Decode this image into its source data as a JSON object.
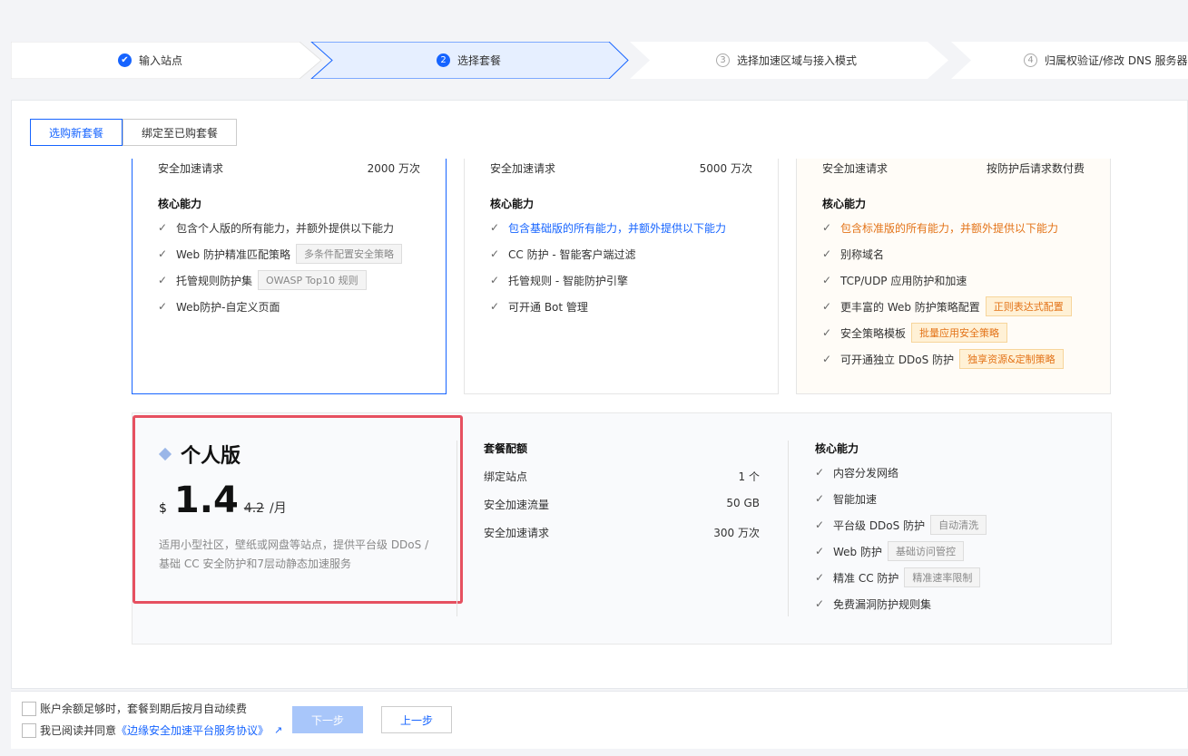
{
  "stepper": {
    "steps": [
      {
        "num": "✔",
        "label": "输入站点",
        "state": "done"
      },
      {
        "num": "2",
        "label": "选择套餐",
        "state": "active"
      },
      {
        "num": "3",
        "label": "选择加速区域与接入模式",
        "state": "todo"
      },
      {
        "num": "4",
        "label": "归属权验证/修改 DNS 服务器",
        "state": "todo"
      }
    ]
  },
  "tabs": {
    "buy_new": "选购新套餐",
    "bind_existing": "绑定至已购套餐"
  },
  "cards": [
    {
      "quota_label": "安全加速请求",
      "quota_value": "2000 万次",
      "core_title": "核心能力",
      "features": [
        {
          "text": "包含个人版的所有能力，并额外提供以下能力",
          "tag": ""
        },
        {
          "text": "Web 防护精准匹配策略",
          "tag": "多条件配置安全策略"
        },
        {
          "text": "托管规则防护集",
          "tag": "OWASP Top10 规则"
        },
        {
          "text": "Web防护-自定义页面",
          "tag": ""
        }
      ]
    },
    {
      "quota_label": "安全加速请求",
      "quota_value": "5000 万次",
      "core_title": "核心能力",
      "features": [
        {
          "text": "包含基础版的所有能力，并额外提供以下能力",
          "tag": ""
        },
        {
          "text": "CC 防护 - 智能客户端过滤",
          "tag": ""
        },
        {
          "text": "托管规则 - 智能防护引擎",
          "tag": ""
        },
        {
          "text": "可开通 Bot 管理",
          "tag": ""
        }
      ]
    },
    {
      "quota_label": "安全加速请求",
      "quota_value": "按防护后请求数付费",
      "core_title": "核心能力",
      "features": [
        {
          "text": "包含标准版的所有能力，并额外提供以下能力",
          "tag": ""
        },
        {
          "text": "别称域名",
          "tag": ""
        },
        {
          "text": "TCP/UDP 应用防护和加速",
          "tag": ""
        },
        {
          "text": "更丰富的 Web 防护策略配置",
          "tag": "正则表达式配置"
        },
        {
          "text": "安全策略模板",
          "tag": "批量应用安全策略"
        },
        {
          "text": "可开通独立 DDoS 防护",
          "tag": "独享资源&定制策略"
        }
      ]
    }
  ],
  "detail": {
    "plan_name": "个人版",
    "currency": "$",
    "price": "1.4",
    "old_price": "4.2",
    "unit": "/月",
    "description": "适用小型社区，壁纸或网盘等站点，提供平台级 DDoS / 基础 CC 安全防护和7层动静态加速服务",
    "quota_title": "套餐配额",
    "quotas": [
      {
        "label": "绑定站点",
        "value": "1 个"
      },
      {
        "label": "安全加速流量",
        "value": "50 GB"
      },
      {
        "label": "安全加速请求",
        "value": "300 万次"
      }
    ],
    "core_title": "核心能力",
    "core_features": [
      {
        "text": "内容分发网络",
        "tag": ""
      },
      {
        "text": "智能加速",
        "tag": ""
      },
      {
        "text": "平台级 DDoS 防护",
        "tag": "自动清洗"
      },
      {
        "text": "Web 防护",
        "tag": "基础访问管控"
      },
      {
        "text": "精准 CC 防护",
        "tag": "精准速率限制"
      },
      {
        "text": "免费漏洞防护规则集",
        "tag": ""
      }
    ]
  },
  "footer": {
    "auto_renew": "账户余额足够时，套餐到期后按月自动续费",
    "agree_prefix": "我已阅读并同意",
    "agree_link": "《边缘安全加速平台服务协议》",
    "next": "下一步",
    "prev": "上一步"
  },
  "colors": {
    "primary": "#1664ff",
    "highlight_border": "#e65060",
    "orange": "#e37318"
  }
}
